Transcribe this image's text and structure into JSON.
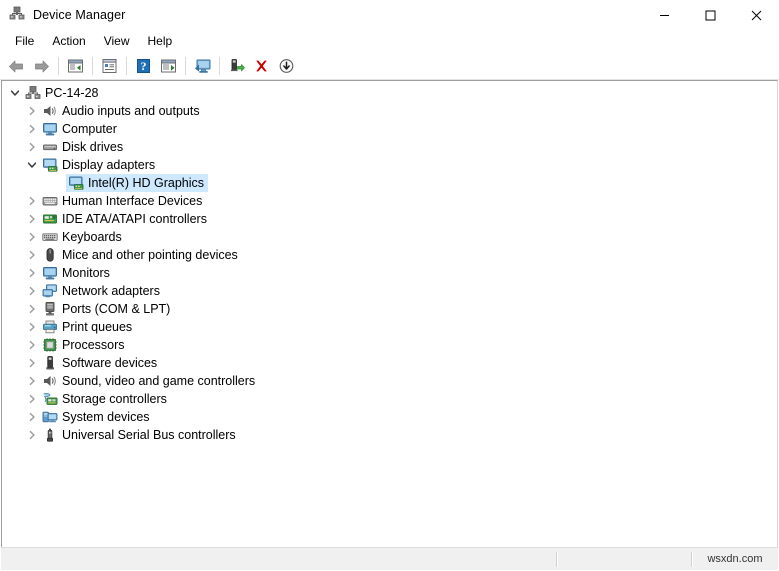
{
  "window": {
    "title": "Device Manager",
    "app_icon": "device-manager-icon",
    "controls": {
      "minimize": "minimize-icon",
      "maximize": "maximize-icon",
      "close": "close-icon"
    }
  },
  "menubar": {
    "items": [
      {
        "label": "File"
      },
      {
        "label": "Action"
      },
      {
        "label": "View"
      },
      {
        "label": "Help"
      }
    ]
  },
  "toolbar": {
    "buttons": [
      {
        "icon": "back-arrow-icon",
        "name": "back-button"
      },
      {
        "icon": "forward-arrow-icon",
        "name": "forward-button"
      },
      {
        "icon": "show-hide-console-tree-icon",
        "name": "show-hide-console-tree-button"
      },
      {
        "icon": "properties-icon",
        "name": "properties-button"
      },
      {
        "icon": "help-icon",
        "name": "help-button"
      },
      {
        "icon": "show-hide-action-pane-icon",
        "name": "show-hide-action-pane-button"
      },
      {
        "icon": "scan-for-hardware-changes-icon",
        "name": "scan-for-hardware-changes-button"
      },
      {
        "icon": "update-driver-icon",
        "name": "update-driver-button"
      },
      {
        "icon": "uninstall-device-icon",
        "name": "uninstall-device-button"
      },
      {
        "icon": "disable-device-icon",
        "name": "disable-device-button"
      }
    ]
  },
  "tree": {
    "nodes": [
      {
        "label": "PC-14-28",
        "depth": 0,
        "state": "expanded",
        "icon": "computer-root-icon",
        "selected": false
      },
      {
        "label": "Audio inputs and outputs",
        "depth": 1,
        "state": "collapsed",
        "icon": "speaker-icon",
        "selected": false
      },
      {
        "label": "Computer",
        "depth": 1,
        "state": "collapsed",
        "icon": "monitor-icon",
        "selected": false
      },
      {
        "label": "Disk drives",
        "depth": 1,
        "state": "collapsed",
        "icon": "disk-drive-icon",
        "selected": false
      },
      {
        "label": "Display adapters",
        "depth": 1,
        "state": "expanded",
        "icon": "display-adapter-icon",
        "selected": false
      },
      {
        "label": "Intel(R) HD Graphics",
        "depth": 2,
        "state": "leaf",
        "icon": "display-adapter-icon",
        "selected": true
      },
      {
        "label": "Human Interface Devices",
        "depth": 1,
        "state": "collapsed",
        "icon": "hid-icon",
        "selected": false
      },
      {
        "label": "IDE ATA/ATAPI controllers",
        "depth": 1,
        "state": "collapsed",
        "icon": "ide-controller-icon",
        "selected": false
      },
      {
        "label": "Keyboards",
        "depth": 1,
        "state": "collapsed",
        "icon": "keyboard-icon",
        "selected": false
      },
      {
        "label": "Mice and other pointing devices",
        "depth": 1,
        "state": "collapsed",
        "icon": "mouse-icon",
        "selected": false
      },
      {
        "label": "Monitors",
        "depth": 1,
        "state": "collapsed",
        "icon": "monitor-icon",
        "selected": false
      },
      {
        "label": "Network adapters",
        "depth": 1,
        "state": "collapsed",
        "icon": "network-adapter-icon",
        "selected": false
      },
      {
        "label": "Ports (COM & LPT)",
        "depth": 1,
        "state": "collapsed",
        "icon": "port-icon",
        "selected": false
      },
      {
        "label": "Print queues",
        "depth": 1,
        "state": "collapsed",
        "icon": "printer-icon",
        "selected": false
      },
      {
        "label": "Processors",
        "depth": 1,
        "state": "collapsed",
        "icon": "processor-icon",
        "selected": false
      },
      {
        "label": "Software devices",
        "depth": 1,
        "state": "collapsed",
        "icon": "software-device-icon",
        "selected": false
      },
      {
        "label": "Sound, video and game controllers",
        "depth": 1,
        "state": "collapsed",
        "icon": "speaker-icon",
        "selected": false
      },
      {
        "label": "Storage controllers",
        "depth": 1,
        "state": "collapsed",
        "icon": "storage-controller-icon",
        "selected": false
      },
      {
        "label": "System devices",
        "depth": 1,
        "state": "collapsed",
        "icon": "system-device-icon",
        "selected": false
      },
      {
        "label": "Universal Serial Bus controllers",
        "depth": 1,
        "state": "collapsed",
        "icon": "usb-icon",
        "selected": false
      }
    ]
  },
  "statusbar": {
    "main_text": "",
    "middle_text": "",
    "watermark": "wsxdn.com"
  },
  "colors": {
    "selection": "#cde8ff",
    "window_bg": "#ffffff",
    "statusbar_bg": "#f0f0f0",
    "accent_red": "#cc0000",
    "accent_green": "#3a9a3a",
    "accent_blue": "#1f6fb5"
  }
}
